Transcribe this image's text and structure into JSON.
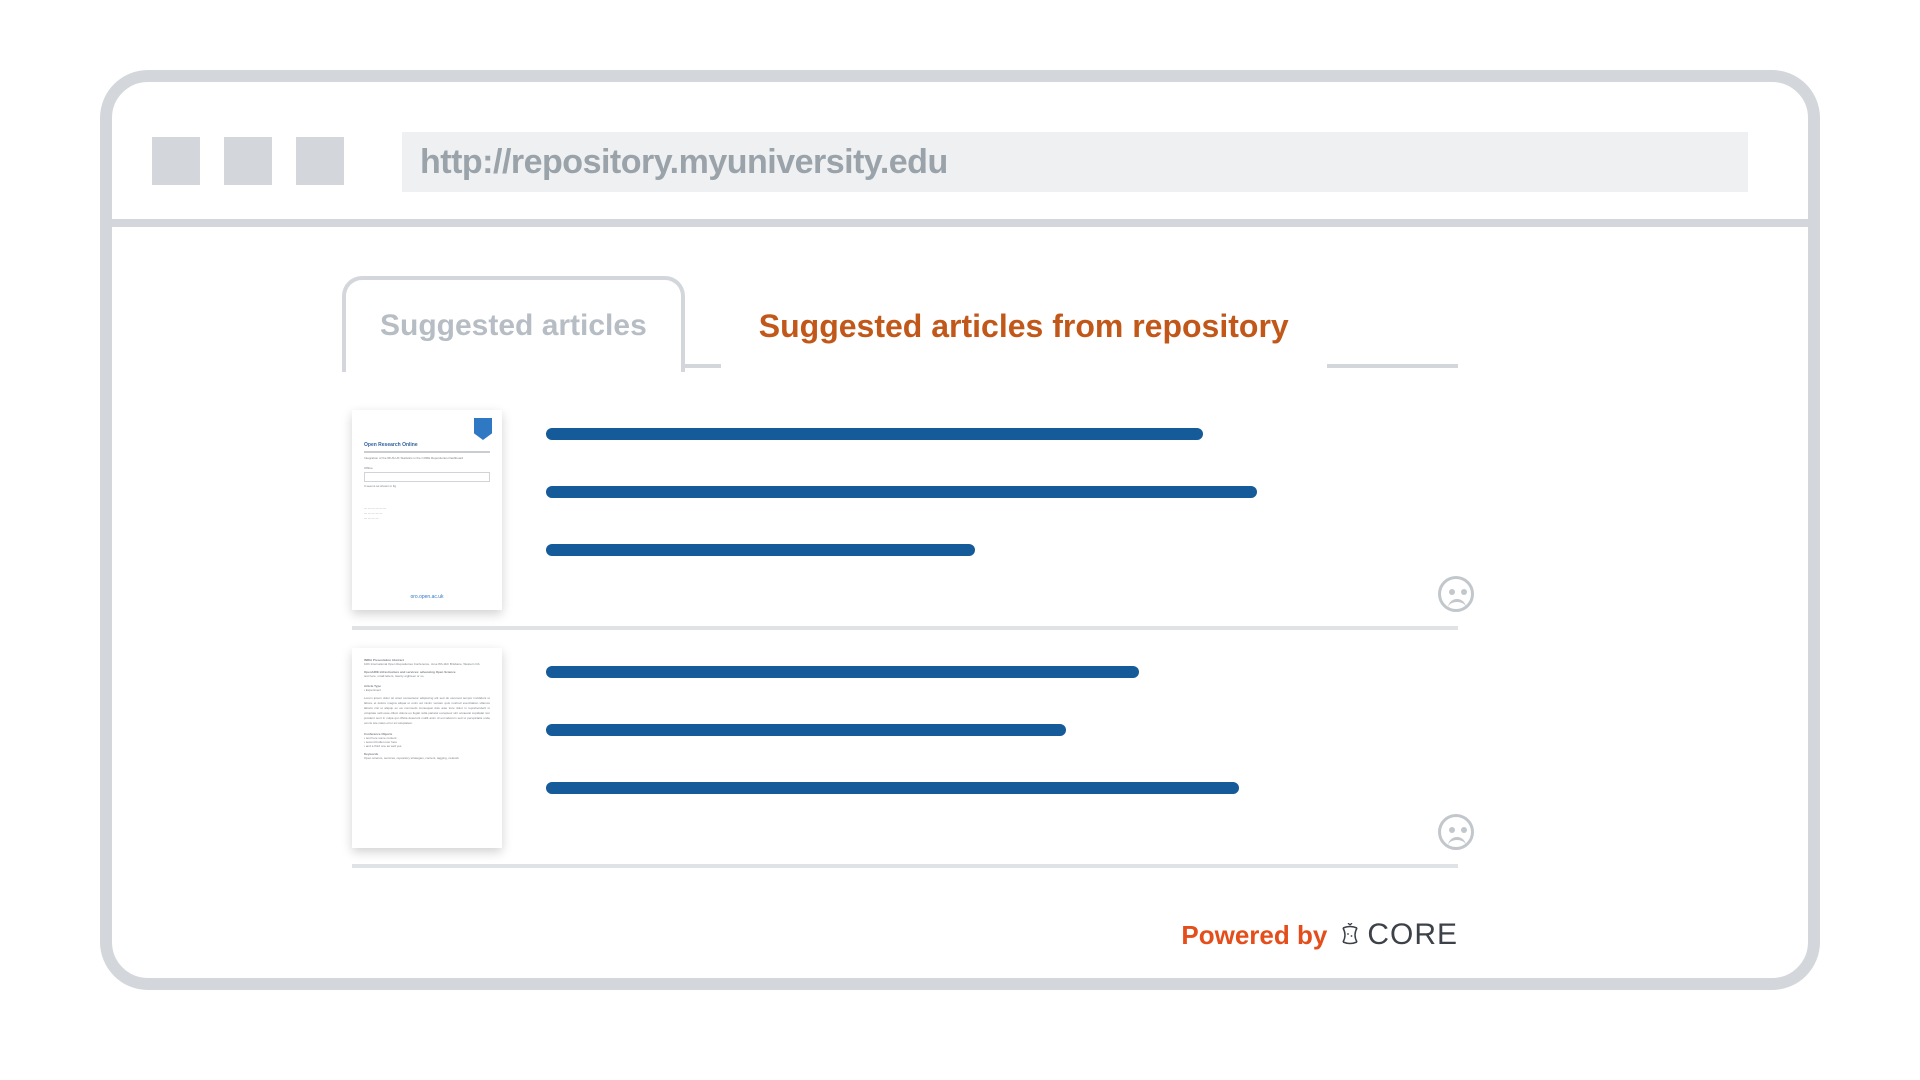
{
  "browser": {
    "url": "http://repository.myuniversity.edu"
  },
  "tabs": {
    "suggested": "Suggested articles",
    "suggested_repo": "Suggested articles from repository"
  },
  "articles": [
    {
      "thumb_title": "Open Research Online",
      "thumb_sub": "Integration of the IRUS-UK Statistics in the CORE Repositories Dashboard",
      "thumb_footer": "oro.open.ac.uk",
      "line_widths": [
        72,
        78,
        47
      ]
    },
    {
      "thumb_title": "OpenAIRE infrastructure and services: advancing Open Science",
      "thumb_sub": "Article Type",
      "thumb_footer": "",
      "line_widths": [
        65,
        57,
        76
      ]
    }
  ],
  "footer": {
    "powered_by": "Powered by",
    "brand": "CORE"
  }
}
